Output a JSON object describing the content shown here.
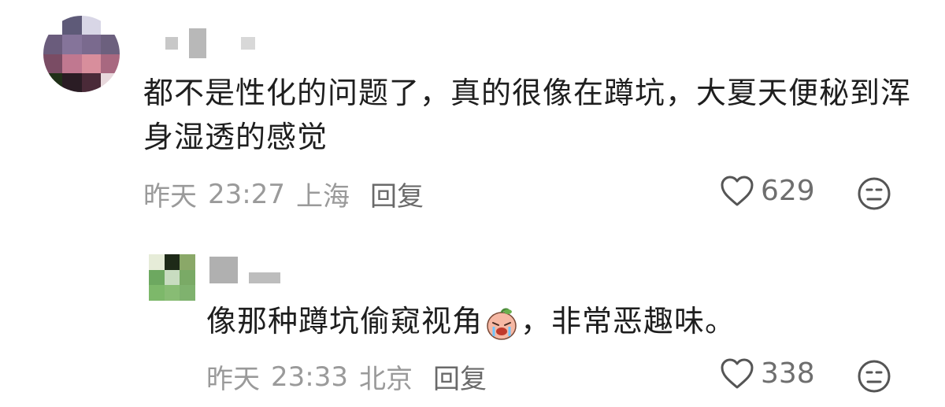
{
  "comments": [
    {
      "text": "都不是性化的问题了，真的很像在蹲坑，大夏天便秘到浑身湿透的感觉",
      "date": "昨天",
      "time": "23:27",
      "location": "上海",
      "reply_label": "回复",
      "likes": "629",
      "like_icon": "heart-outline-icon",
      "dislike_icon": "frown-face-icon"
    },
    {
      "text_before": "像那种蹲坑偷窥视角",
      "emoji": "crying-peach-emoji",
      "text_after": "，非常恶趣味。",
      "date": "昨天",
      "time": "23:33",
      "location": "北京",
      "reply_label": "回复",
      "likes": "338",
      "like_icon": "heart-outline-icon",
      "dislike_icon": "frown-face-icon"
    }
  ],
  "colors": {
    "text": "#1e1e1e",
    "meta": "#9a9a9a",
    "reply": "#6a6a6a",
    "icon": "#555555"
  }
}
